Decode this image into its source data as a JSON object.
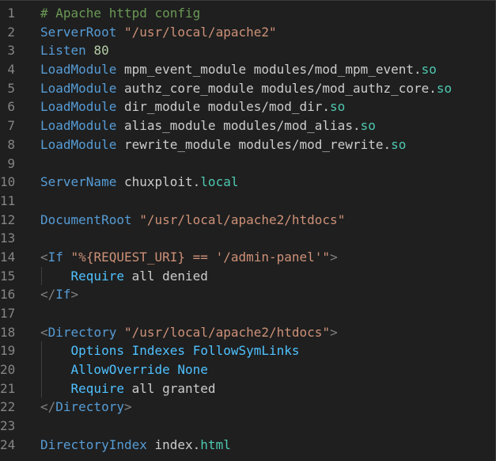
{
  "editor": {
    "language": "apache-config",
    "lines": [
      {
        "num": "1",
        "tokens": [
          {
            "t": "# Apache httpd config",
            "c": "comment"
          }
        ]
      },
      {
        "num": "2",
        "tokens": [
          {
            "t": "ServerRoot",
            "c": "dir"
          },
          {
            "t": " ",
            "c": "plain"
          },
          {
            "t": "\"/usr/local/apache2\"",
            "c": "str"
          }
        ]
      },
      {
        "num": "3",
        "tokens": [
          {
            "t": "Listen",
            "c": "dir"
          },
          {
            "t": " ",
            "c": "plain"
          },
          {
            "t": "80",
            "c": "num"
          }
        ]
      },
      {
        "num": "4",
        "tokens": [
          {
            "t": "LoadModule",
            "c": "dir"
          },
          {
            "t": " mpm_event_module modules/mod_mpm_event.",
            "c": "plain"
          },
          {
            "t": "so",
            "c": "ext"
          }
        ]
      },
      {
        "num": "5",
        "tokens": [
          {
            "t": "LoadModule",
            "c": "dir"
          },
          {
            "t": " authz_core_module modules/mod_authz_core.",
            "c": "plain"
          },
          {
            "t": "so",
            "c": "ext"
          }
        ]
      },
      {
        "num": "6",
        "tokens": [
          {
            "t": "LoadModule",
            "c": "dir"
          },
          {
            "t": " dir_module modules/mod_dir.",
            "c": "plain"
          },
          {
            "t": "so",
            "c": "ext"
          }
        ]
      },
      {
        "num": "7",
        "tokens": [
          {
            "t": "LoadModule",
            "c": "dir"
          },
          {
            "t": " alias_module modules/mod_alias.",
            "c": "plain"
          },
          {
            "t": "so",
            "c": "ext"
          }
        ]
      },
      {
        "num": "8",
        "tokens": [
          {
            "t": "LoadModule",
            "c": "dir"
          },
          {
            "t": " rewrite_module modules/mod_rewrite.",
            "c": "plain"
          },
          {
            "t": "so",
            "c": "ext"
          }
        ]
      },
      {
        "num": "9",
        "tokens": []
      },
      {
        "num": "10",
        "tokens": [
          {
            "t": "ServerName",
            "c": "dir"
          },
          {
            "t": " chuxploit.",
            "c": "plain"
          },
          {
            "t": "local",
            "c": "ext"
          }
        ]
      },
      {
        "num": "11",
        "tokens": []
      },
      {
        "num": "12",
        "tokens": [
          {
            "t": "DocumentRoot",
            "c": "dir"
          },
          {
            "t": " ",
            "c": "plain"
          },
          {
            "t": "\"/usr/local/apache2/htdocs\"",
            "c": "str"
          }
        ]
      },
      {
        "num": "13",
        "tokens": []
      },
      {
        "num": "14",
        "tokens": [
          {
            "t": "<",
            "c": "punct"
          },
          {
            "t": "If",
            "c": "tag"
          },
          {
            "t": " ",
            "c": "plain"
          },
          {
            "t": "\"%{REQUEST_URI} == '/admin-panel'\"",
            "c": "str"
          },
          {
            "t": ">",
            "c": "punct"
          }
        ]
      },
      {
        "num": "15",
        "guide": true,
        "tokens": [
          {
            "t": "    ",
            "c": "plain"
          },
          {
            "t": "Require",
            "c": "dir2"
          },
          {
            "t": " all denied",
            "c": "plain"
          }
        ]
      },
      {
        "num": "16",
        "tokens": [
          {
            "t": "</",
            "c": "punct"
          },
          {
            "t": "If",
            "c": "tag"
          },
          {
            "t": ">",
            "c": "punct"
          }
        ]
      },
      {
        "num": "17",
        "tokens": []
      },
      {
        "num": "18",
        "tokens": [
          {
            "t": "<",
            "c": "punct"
          },
          {
            "t": "Directory",
            "c": "tag"
          },
          {
            "t": " ",
            "c": "plain"
          },
          {
            "t": "\"/usr/local/apache2/htdocs\"",
            "c": "str"
          },
          {
            "t": ">",
            "c": "punct"
          }
        ]
      },
      {
        "num": "19",
        "guide": true,
        "tokens": [
          {
            "t": "    ",
            "c": "plain"
          },
          {
            "t": "Options",
            "c": "dir2"
          },
          {
            "t": " ",
            "c": "plain"
          },
          {
            "t": "Indexes",
            "c": "dir2"
          },
          {
            "t": " ",
            "c": "plain"
          },
          {
            "t": "FollowSymLinks",
            "c": "dir2"
          }
        ]
      },
      {
        "num": "20",
        "guide": true,
        "tokens": [
          {
            "t": "    ",
            "c": "plain"
          },
          {
            "t": "AllowOverride",
            "c": "dir2"
          },
          {
            "t": " ",
            "c": "plain"
          },
          {
            "t": "None",
            "c": "dir2"
          }
        ]
      },
      {
        "num": "21",
        "guide": true,
        "tokens": [
          {
            "t": "    ",
            "c": "plain"
          },
          {
            "t": "Require",
            "c": "dir2"
          },
          {
            "t": " all granted",
            "c": "plain"
          }
        ]
      },
      {
        "num": "22",
        "tokens": [
          {
            "t": "</",
            "c": "punct"
          },
          {
            "t": "Directory",
            "c": "tag"
          },
          {
            "t": ">",
            "c": "punct"
          }
        ]
      },
      {
        "num": "23",
        "tokens": []
      },
      {
        "num": "24",
        "tokens": [
          {
            "t": "DirectoryIndex",
            "c": "dir"
          },
          {
            "t": " index.",
            "c": "plain"
          },
          {
            "t": "html",
            "c": "ext"
          }
        ]
      }
    ]
  },
  "colors": {
    "background": "#1f1f1f",
    "line_number": "#858585",
    "comment": "#6a9955",
    "directive": "#569cd6",
    "string": "#ce9178",
    "number": "#b5cea8",
    "text": "#cccccc"
  }
}
